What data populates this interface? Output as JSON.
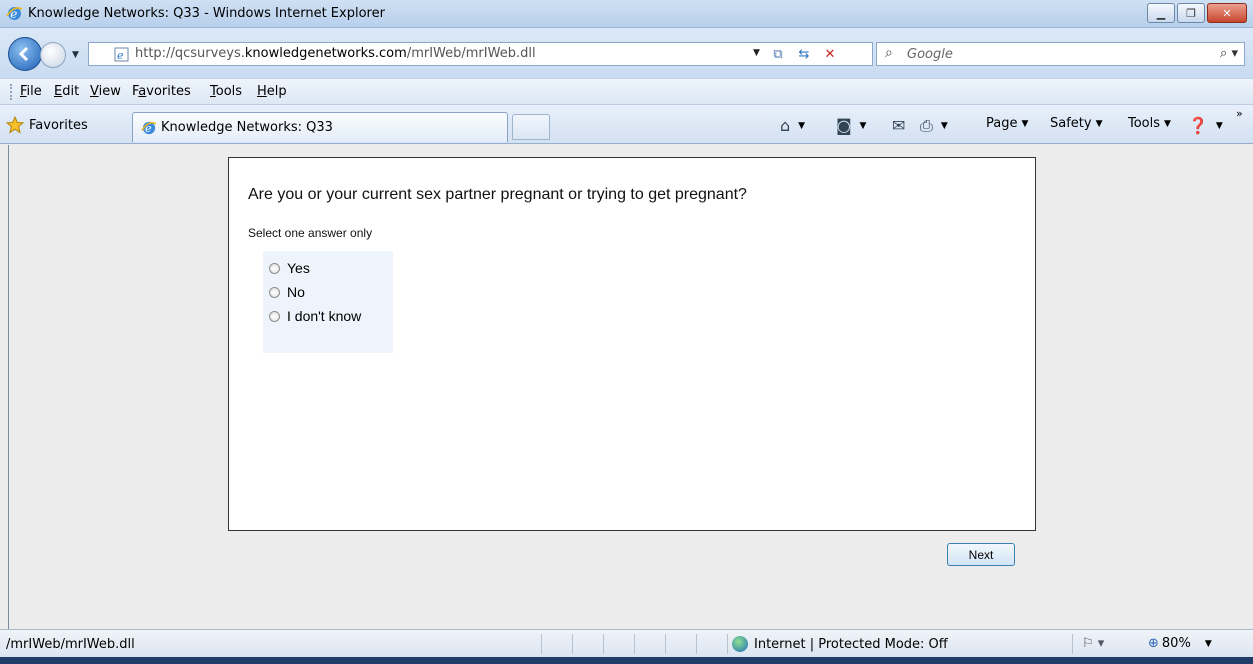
{
  "window": {
    "title": "Knowledge Networks: Q33 - Windows Internet Explorer"
  },
  "address": {
    "url_prefix": "http://qcsurveys.",
    "url_domain": "knowledgenetworks.com",
    "url_path": "/mrIWeb/mrIWeb.dll",
    "search_placeholder": "Google"
  },
  "menu": {
    "items": [
      {
        "label": "File",
        "key": "F"
      },
      {
        "label": "Edit",
        "key": "E"
      },
      {
        "label": "View",
        "key": "V"
      },
      {
        "label": "Favorites",
        "key": "a"
      },
      {
        "label": "Tools",
        "key": "T"
      },
      {
        "label": "Help",
        "key": "H"
      }
    ]
  },
  "favbar": {
    "favorites_label": "Favorites",
    "tab_title": "Knowledge Networks: Q33",
    "page_label": "Page",
    "safety_label": "Safety",
    "tools_label": "Tools"
  },
  "survey": {
    "question": "Are you or your current sex partner pregnant or trying to get pregnant?",
    "instruction": "Select one answer only",
    "options": [
      "Yes",
      "No",
      "I don't know"
    ],
    "next_label": "Next"
  },
  "status": {
    "link": "/mrIWeb/mrIWeb.dll",
    "zone": "Internet | Protected Mode: Off",
    "zoom": "80%"
  },
  "colors": {
    "accent": "#1d5fb4",
    "content_bg": "#ececec",
    "answers_bg": "#eef4fb"
  },
  "icons": [
    "ie-logo-icon",
    "back-icon",
    "forward-icon",
    "refresh-icon",
    "stop-icon",
    "search-icon",
    "favorites-star-icon",
    "home-icon",
    "feeds-icon",
    "mail-icon",
    "print-icon",
    "help-icon",
    "globe-icon"
  ]
}
